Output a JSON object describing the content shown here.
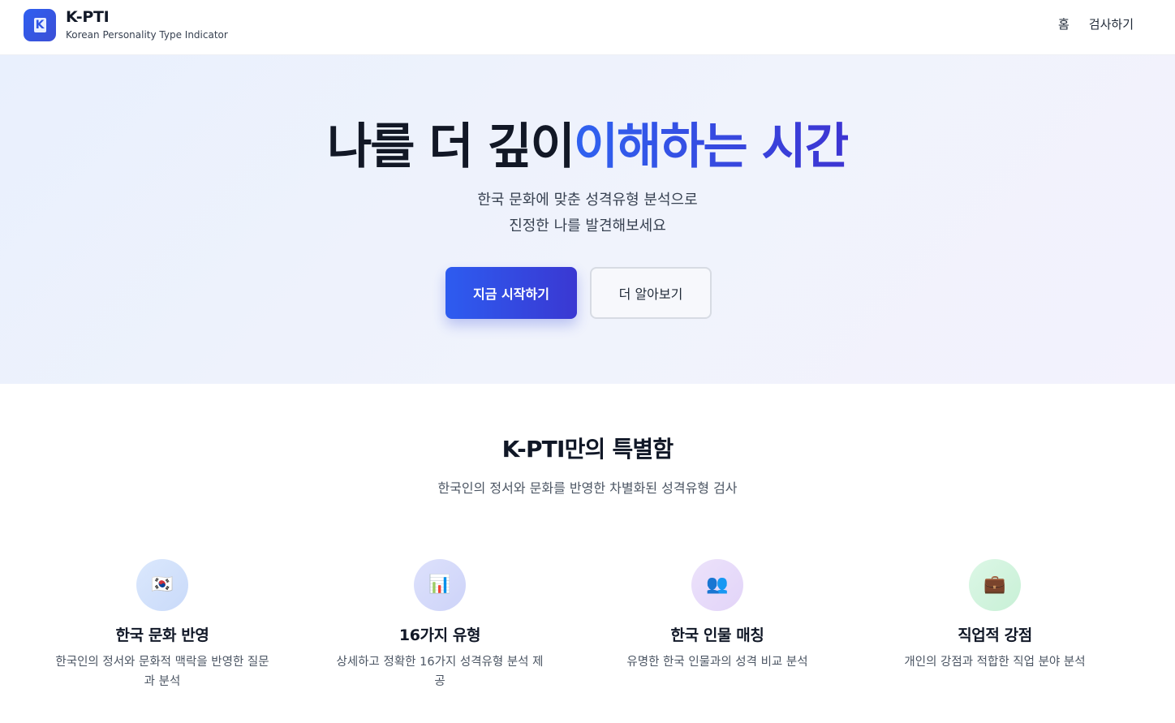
{
  "header": {
    "logo_letter": "K",
    "title": "K-PTI",
    "subtitle": "Korean Personality Type Indicator",
    "nav": [
      {
        "label": "홈"
      },
      {
        "label": "검사하기"
      }
    ]
  },
  "hero": {
    "title_dark": "나를 더 깊이",
    "title_accent": "이해하는 시간",
    "desc_line1": "한국 문화에 맞춘 성격유형 분석으로",
    "desc_line2": "진정한 나를 발견해보세요",
    "primary_button": "지금 시작하기",
    "secondary_button": "더 알아보기"
  },
  "features": {
    "title": "K-PTI만의 특별함",
    "subtitle": "한국인의 정서와 문화를 반영한 차별화된 성격유형 검사",
    "items": [
      {
        "icon": "korea-flag-icon",
        "glyph": "🇰🇷",
        "title": "한국 문화 반영",
        "desc": "한국인의 정서와 문화적 맥락을 반영한 질문과 분석"
      },
      {
        "icon": "bar-chart-icon",
        "glyph": "📊",
        "title": "16가지 유형",
        "desc": "상세하고 정확한 16가지 성격유형 분석 제공"
      },
      {
        "icon": "people-icon",
        "glyph": "👥",
        "title": "한국 인물 매칭",
        "desc": "유명한 한국 인물과의 성격 비교 분석"
      },
      {
        "icon": "briefcase-icon",
        "glyph": "💼",
        "title": "직업적 강점",
        "desc": "개인의 강점과 적합한 직업 분야 분석"
      }
    ]
  },
  "colors": {
    "brand": "#2f5ff0",
    "accent_gradient_start": "#2f62f0",
    "accent_gradient_end": "#3d34d2",
    "hero_bg": "#eef2fc"
  }
}
